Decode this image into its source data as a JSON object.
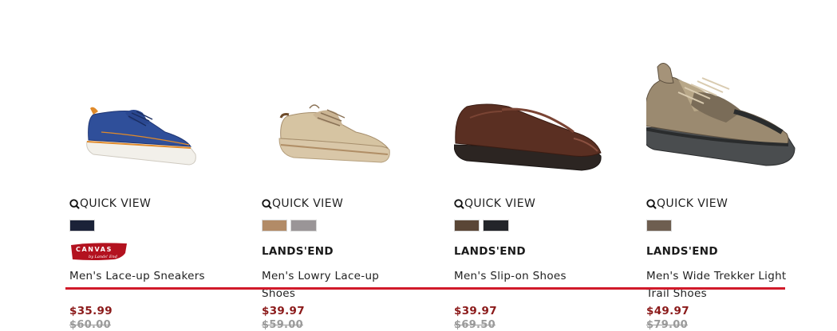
{
  "products": [
    {
      "quick_view": "QUICK VIEW",
      "swatches": [
        "#1b2238"
      ],
      "brand": "CANVAS",
      "brand_sub": "by Lands' End",
      "name": "Men's Lace-up Sneakers",
      "price": "$35.99",
      "original_price": "$60.00"
    },
    {
      "quick_view": "QUICK VIEW",
      "swatches": [
        "#b28b67",
        "#9a9597"
      ],
      "brand": "LANDS'END",
      "name": "Men's Lowry Lace-up Shoes",
      "price": "$39.97",
      "original_price": "$59.00"
    },
    {
      "quick_view": "QUICK VIEW",
      "swatches": [
        "#5a4636",
        "#23252a"
      ],
      "brand": "LANDS'END",
      "name": "Men's Slip-on Shoes",
      "price": "$39.97",
      "original_price": "$69.50"
    },
    {
      "quick_view": "QUICK VIEW",
      "swatches": [
        "#6e5e50"
      ],
      "brand": "LANDS'END",
      "name": "Men's Wide Trekker Light Trail Shoes",
      "price": "$49.97",
      "original_price": "$79.00"
    }
  ],
  "colors": {
    "price": "#8b1a1a",
    "highlight_line": "#d11a2a",
    "canvas_logo": "#b3121f"
  },
  "icons": [
    "search-icon"
  ]
}
